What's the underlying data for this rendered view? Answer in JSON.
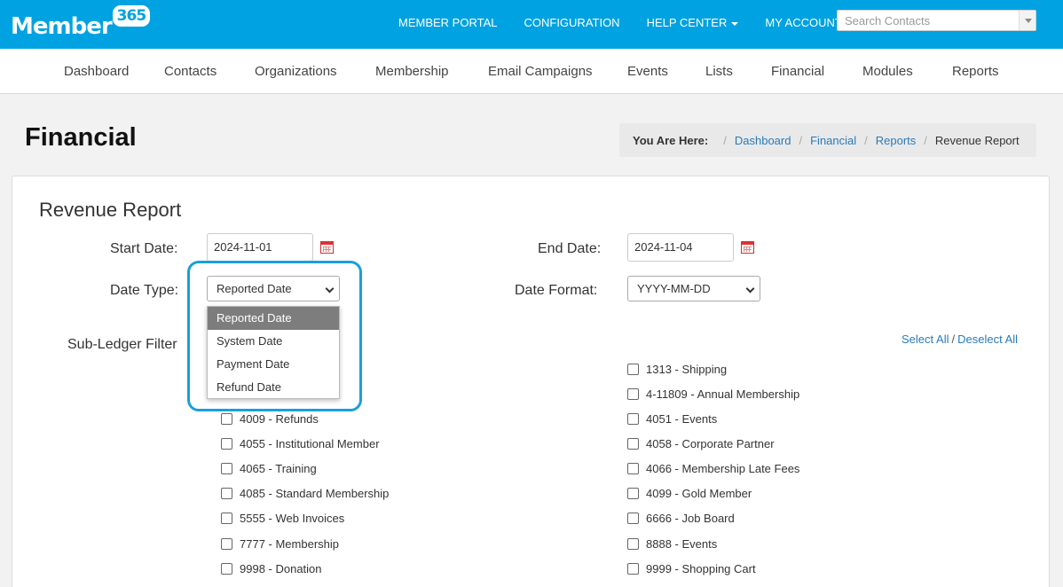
{
  "brand": {
    "logo_text": "Member",
    "logo_badge": "365"
  },
  "topnav": {
    "items": [
      {
        "label": "MEMBER PORTAL",
        "dropdown": false
      },
      {
        "label": "CONFIGURATION",
        "dropdown": false
      },
      {
        "label": "HELP CENTER",
        "dropdown": true
      },
      {
        "label": "MY ACCOUNT",
        "dropdown": true
      }
    ],
    "search_placeholder": "Search Contacts"
  },
  "mainnav": {
    "items": [
      "Dashboard",
      "Contacts",
      "Organizations",
      "Membership",
      "Email Campaigns",
      "Events",
      "Lists",
      "Financial",
      "Modules",
      "Reports"
    ]
  },
  "page": {
    "title": "Financial",
    "breadcrumb": {
      "label": "You Are Here:",
      "links": [
        "Dashboard",
        "Financial",
        "Reports"
      ],
      "current": "Revenue Report"
    }
  },
  "form": {
    "title": "Revenue Report",
    "start_date_label": "Start Date:",
    "start_date_value": "2024-11-01",
    "end_date_label": "End Date:",
    "end_date_value": "2024-11-04",
    "date_type_label": "Date Type:",
    "date_type_value": "Reported Date",
    "date_type_options": [
      "Reported Date",
      "System Date",
      "Payment Date",
      "Refund Date"
    ],
    "date_format_label": "Date Format:",
    "date_format_value": "YYYY-MM-DD",
    "subledger_label": "Sub-Ledger Filter",
    "select_all": "Select All",
    "separator": "/",
    "deselect_all": "Deselect All",
    "left_items": [
      "4009 - Refunds",
      "4055 - Institutional Member",
      "4065 - Training",
      "4085 - Standard Membership",
      "5555 - Web Invoices",
      "7777 - Membership",
      "9998 - Donation"
    ],
    "right_items": [
      "1313 - Shipping",
      "4-11809 - Annual Membership",
      "4051 - Events",
      "4058 - Corporate Partner",
      "4066 - Membership Late Fees",
      "4099 - Gold Member",
      "6666 - Job Board",
      "8888 - Events",
      "9999 - Shopping Cart"
    ]
  },
  "colors": {
    "brand": "#00a2e2",
    "link": "#2a7ab8",
    "highlight": "#1a9fd9"
  }
}
